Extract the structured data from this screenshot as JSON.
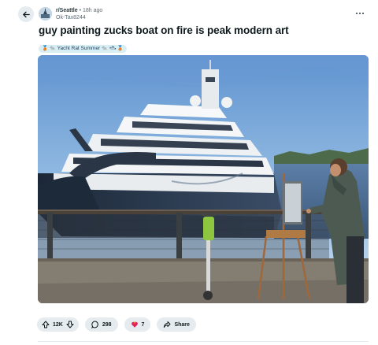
{
  "post": {
    "subreddit": "r/Seattle",
    "separator": "•",
    "time_ago": "18h ago",
    "username": "Ok-Tax8244",
    "title": "guy painting zucks boat on fire is peak modern art",
    "flair": "🥉 🐀 Yacht Rat Summer 🐀 🛥 🥉"
  },
  "actions": {
    "votes": "12K",
    "comments": "298",
    "awards": "7",
    "share_label": "Share"
  },
  "icons": {
    "back": "arrow-left-icon",
    "more": "more-horizontal-icon",
    "upvote": "upvote-arrow-icon",
    "downvote": "downvote-arrow-icon",
    "comment": "comment-bubble-icon",
    "award": "award-heart-icon",
    "share": "share-arrow-icon"
  },
  "colors": {
    "pill_bg": "#e5ebee",
    "flair_bg": "#d7eef4",
    "award": "#e0245e"
  }
}
